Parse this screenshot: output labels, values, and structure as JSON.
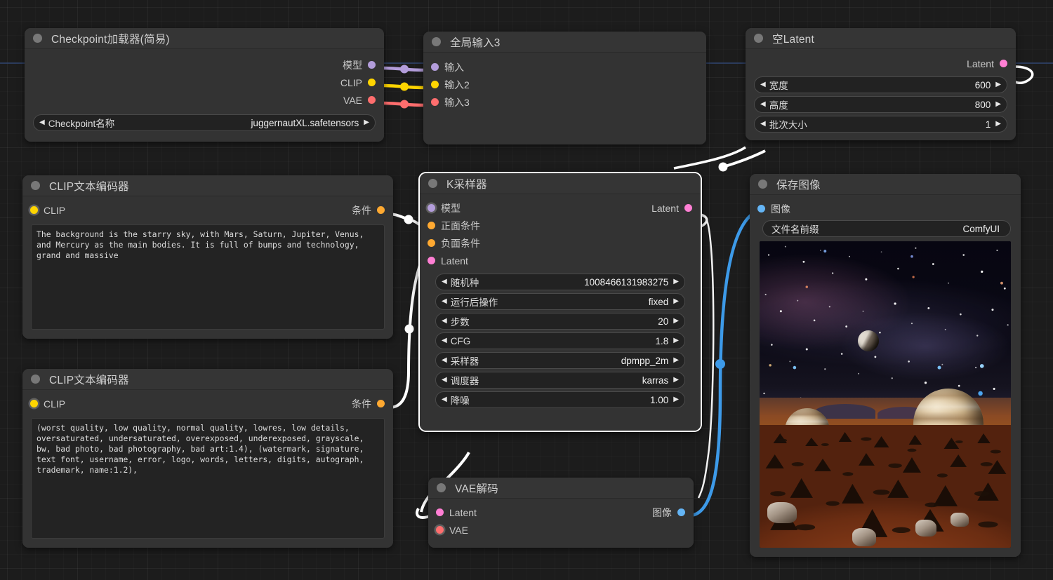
{
  "app": {
    "name": "ComfyUI",
    "canvas_bg": "#1c1c1c"
  },
  "nodes": {
    "checkpoint_loader": {
      "title": "Checkpoint加载器(简易)",
      "outputs": [
        {
          "label": "模型",
          "color": "#b39ddb"
        },
        {
          "label": "CLIP",
          "color": "#ffd500"
        },
        {
          "label": "VAE",
          "color": "#ff6e6e"
        }
      ],
      "widgets": [
        {
          "name": "Checkpoint名称",
          "value": "juggernautXL.safetensors"
        }
      ]
    },
    "global_input": {
      "title": "全局输入3",
      "inputs": [
        {
          "label": "输入",
          "color": "#b39ddb"
        },
        {
          "label": "输入2",
          "color": "#ffd500"
        },
        {
          "label": "输入3",
          "color": "#ff6e6e"
        }
      ]
    },
    "empty_latent": {
      "title": "空Latent",
      "outputs": [
        {
          "label": "Latent",
          "color": "#ff7fd4"
        }
      ],
      "widgets": [
        {
          "name": "宽度",
          "value": "600"
        },
        {
          "name": "高度",
          "value": "800"
        },
        {
          "name": "批次大小",
          "value": "1"
        }
      ]
    },
    "clip_positive": {
      "title": "CLIP文本编码器",
      "inputs": [
        {
          "label": "CLIP",
          "color": "#ffd500"
        }
      ],
      "outputs": [
        {
          "label": "条件",
          "color": "#ffa931"
        }
      ],
      "text": "The background is the starry sky, with Mars, Saturn, Jupiter, Venus, and Mercury as the main bodies. It is full of bumps and technology, grand and massive"
    },
    "clip_negative": {
      "title": "CLIP文本编码器",
      "inputs": [
        {
          "label": "CLIP",
          "color": "#ffd500"
        }
      ],
      "outputs": [
        {
          "label": "条件",
          "color": "#ffa931"
        }
      ],
      "text": "(worst quality, low quality, normal quality, lowres, low details, oversaturated, undersaturated, overexposed, underexposed, grayscale, bw, bad photo, bad photography, bad art:1.4), (watermark, signature, text font, username, error, logo, words, letters, digits, autograph, trademark, name:1.2),"
    },
    "ksampler": {
      "title": "K采样器",
      "selected": true,
      "inputs": [
        {
          "label": "模型",
          "color": "#b39ddb"
        },
        {
          "label": "正面条件",
          "color": "#ffa931"
        },
        {
          "label": "负面条件",
          "color": "#ffa931"
        },
        {
          "label": "Latent",
          "color": "#ff7fd4"
        }
      ],
      "outputs": [
        {
          "label": "Latent",
          "color": "#ff7fd4"
        }
      ],
      "widgets": [
        {
          "name": "随机种",
          "value": "1008466131983275"
        },
        {
          "name": "运行后操作",
          "value": "fixed"
        },
        {
          "name": "步数",
          "value": "20"
        },
        {
          "name": "CFG",
          "value": "1.8"
        },
        {
          "name": "采样器",
          "value": "dpmpp_2m"
        },
        {
          "name": "调度器",
          "value": "karras"
        },
        {
          "name": "降噪",
          "value": "1.00"
        }
      ]
    },
    "vae_decode": {
      "title": "VAE解码",
      "inputs": [
        {
          "label": "Latent",
          "color": "#ff7fd4"
        },
        {
          "label": "VAE",
          "color": "#ff6e6e"
        }
      ],
      "outputs": [
        {
          "label": "图像",
          "color": "#64b5f6"
        }
      ]
    },
    "save_image": {
      "title": "保存图像",
      "inputs": [
        {
          "label": "图像",
          "color": "#64b5f6"
        }
      ],
      "widgets": [
        {
          "name": "文件名前缀",
          "value": "ComfyUI"
        }
      ],
      "preview_alt": "Starry sky over red Martian terrain with Jupiter, Saturn and a moon"
    }
  }
}
